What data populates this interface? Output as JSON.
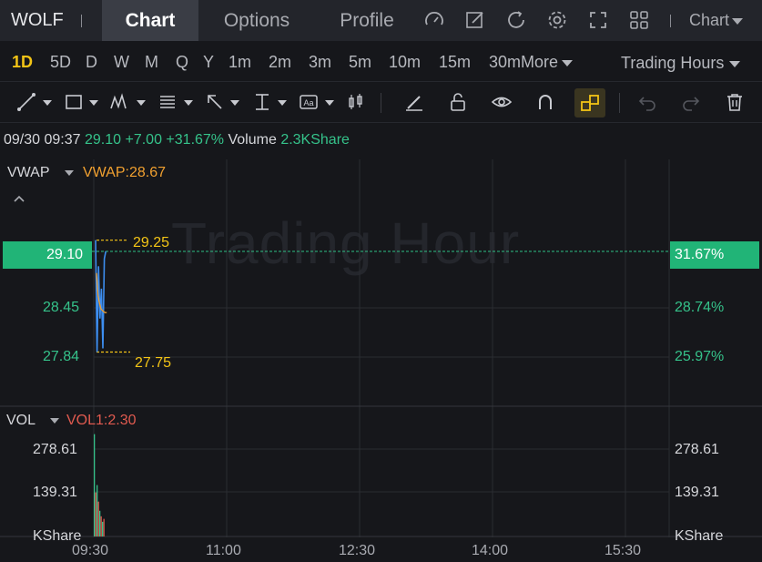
{
  "header": {
    "ticker": "WOLF",
    "tabs": [
      "Chart",
      "Options",
      "Profile"
    ],
    "chart_menu": "Chart"
  },
  "intervals": {
    "items": [
      "1D",
      "5D",
      "D",
      "W",
      "M",
      "Q",
      "Y",
      "1m",
      "2m",
      "3m",
      "5m",
      "10m",
      "15m",
      "30m"
    ],
    "more": "More",
    "active": "1D",
    "session": "Trading Hours"
  },
  "quote": {
    "datetime": "09/30 09:37",
    "price": "29.10",
    "change": "+7.00",
    "change_pct": "+31.67%",
    "volume_label": "Volume",
    "volume_value": "2.3KShare"
  },
  "price_panel": {
    "indicator": "VWAP",
    "indicator_value": "VWAP:28.67",
    "watermark": "Trading Hour",
    "current_price": "29.10",
    "current_pct": "31.67%",
    "high_marker": "29.25",
    "low_marker": "27.75",
    "left_ticks": [
      "28.45",
      "27.84"
    ],
    "right_ticks": [
      "28.74%",
      "25.97%"
    ]
  },
  "volume_panel": {
    "indicator": "VOL",
    "indicator_value": "VOL1:2.30",
    "left_ticks": [
      "278.61",
      "139.31",
      "KShare"
    ],
    "right_ticks": [
      "278.61",
      "139.31",
      "KShare"
    ]
  },
  "x_axis": {
    "ticks": [
      "09:30",
      "11:00",
      "12:30",
      "14:00",
      "15:30"
    ]
  },
  "colors": {
    "up": "#35c28a",
    "down": "#e05a4f",
    "price_line": "#3d8ef0",
    "vwap_line": "#f0a030",
    "marker": "#f3c416",
    "accent": "#f3c416"
  },
  "chart_data": {
    "type": "line",
    "title": "",
    "x": [
      "09:30",
      "09:31",
      "09:32",
      "09:33",
      "09:34",
      "09:35",
      "09:36",
      "09:37"
    ],
    "series": [
      {
        "name": "",
        "values": [
          29.25,
          27.75,
          28.9,
          28.2,
          28.6,
          27.8,
          29.0,
          29.1
        ]
      },
      {
        "name": "VWAP",
        "values": [
          29.2,
          28.9,
          28.8,
          28.72,
          28.7,
          28.68,
          28.67,
          28.67
        ]
      }
    ],
    "ylim": [
      27.5,
      29.6
    ],
    "volume": {
      "values": [
        278.61,
        120,
        140,
        95,
        70,
        55,
        40,
        48
      ],
      "ylim": [
        0,
        300
      ]
    }
  }
}
